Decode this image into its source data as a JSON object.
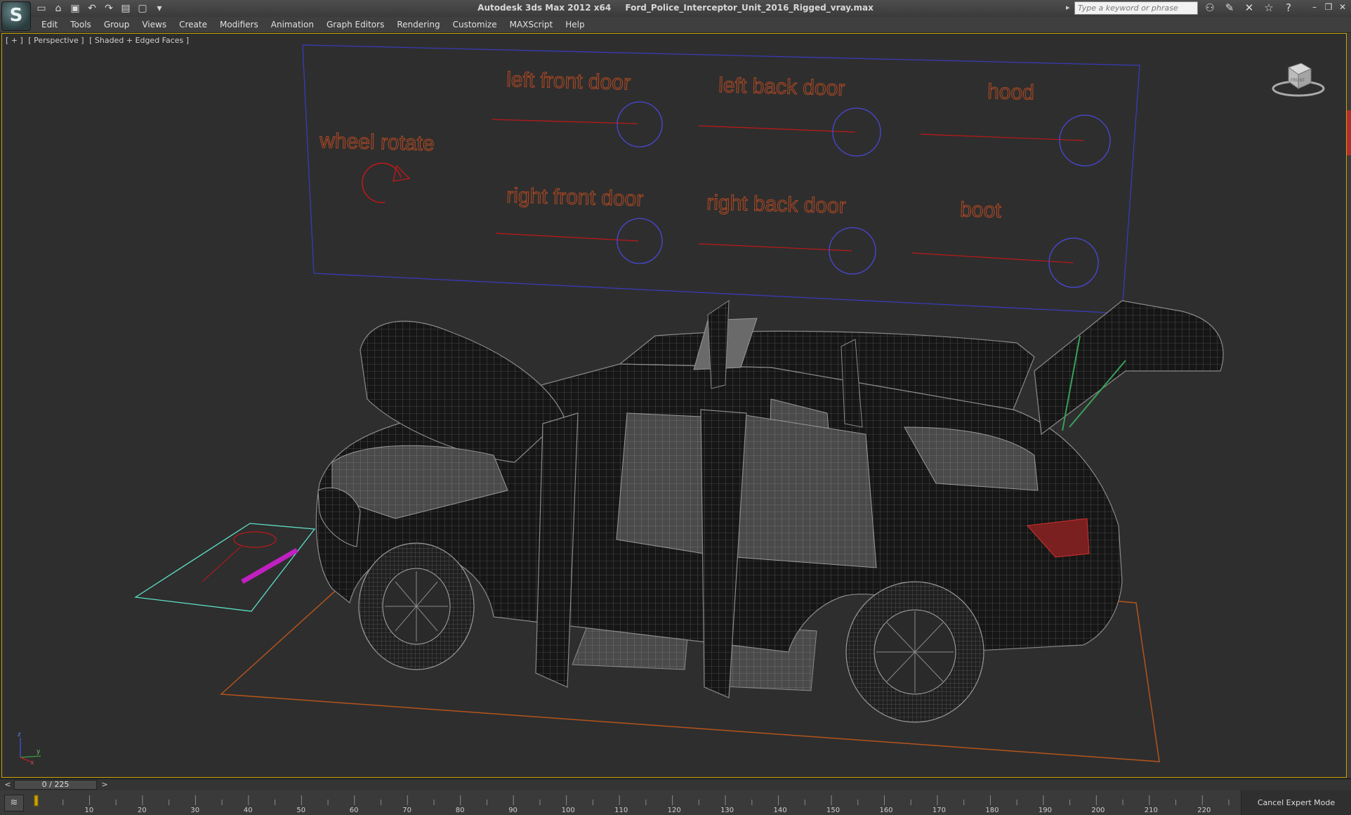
{
  "app": {
    "title": "Autodesk 3ds Max  2012 x64",
    "file": "Ford_Police_Interceptor_Unit_2016_Rigged_vray.max",
    "logo": "S"
  },
  "toolbar_icons": [
    "new-icon",
    "open-icon",
    "save-icon",
    "undo-icon",
    "redo-icon",
    "project-icon",
    "window-icon",
    "dropdown-icon"
  ],
  "search": {
    "placeholder": "Type a keyword or phrase"
  },
  "menu": [
    "Edit",
    "Tools",
    "Group",
    "Views",
    "Create",
    "Modifiers",
    "Animation",
    "Graph Editors",
    "Rendering",
    "Customize",
    "MAXScript",
    "Help"
  ],
  "viewport": {
    "label_plus": "[ + ]",
    "label_view": "[ Perspective ]",
    "label_shading": "[ Shaded + Edged Faces ]",
    "viewcube_label": "FRONT"
  },
  "rig_panel": {
    "wheel_rotate": "wheel rotate",
    "left_front_door": "left front door",
    "left_back_door": "left back door",
    "hood": "hood",
    "right_front_door": "right front door",
    "right_back_door": "right back door",
    "boot": "boot",
    "color": "#b54a22",
    "line_color": "#c01818",
    "circle_color": "#4a48d8"
  },
  "axis": {
    "x": "x",
    "y": "y",
    "z": "z"
  },
  "timeline": {
    "frame_display": "0 / 225",
    "prev": "<",
    "next": ">",
    "ticks": [
      "10",
      "20",
      "30",
      "40",
      "50",
      "60",
      "70",
      "80",
      "90",
      "100",
      "110",
      "120",
      "130",
      "140",
      "150",
      "160",
      "170",
      "180",
      "190",
      "200",
      "210",
      "220"
    ]
  },
  "status": {
    "cancel_expert": "Cancel Expert Mode"
  },
  "colors": {
    "viewport_bg": "#2e2e2e",
    "active_border": "#c9a200",
    "wireframe_dark": "#151515",
    "wireframe_line": "#7a7a7a",
    "grid_orange": "#b4541c",
    "helper_cyan": "#5ee0c8",
    "helper_magenta": "#c020c0"
  }
}
